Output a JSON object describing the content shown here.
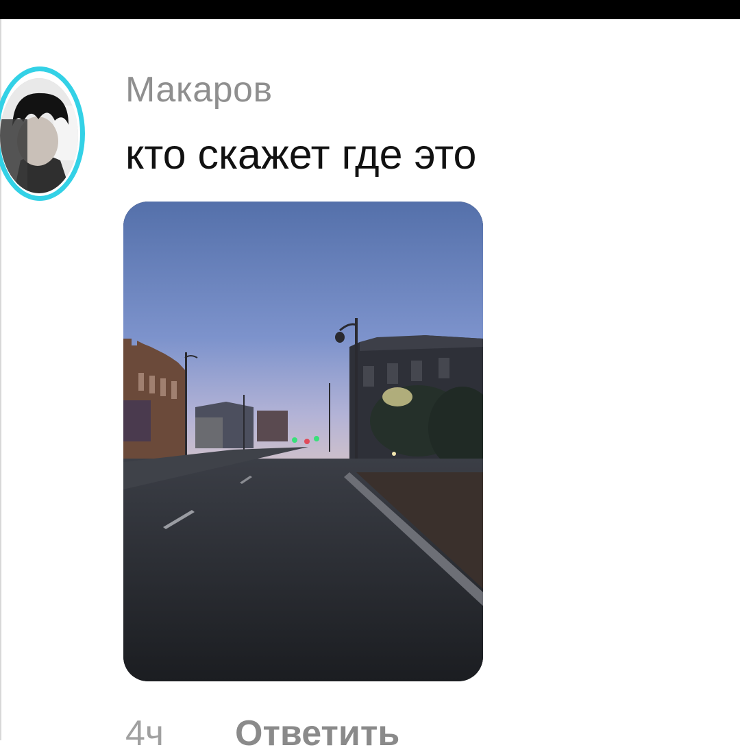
{
  "comment": {
    "author": "Макаров",
    "text": "кто скажет где это",
    "time": "4ч",
    "reply_label": "Ответить",
    "avatar_ring_color": "#33d1e6",
    "attachment": "photo"
  }
}
